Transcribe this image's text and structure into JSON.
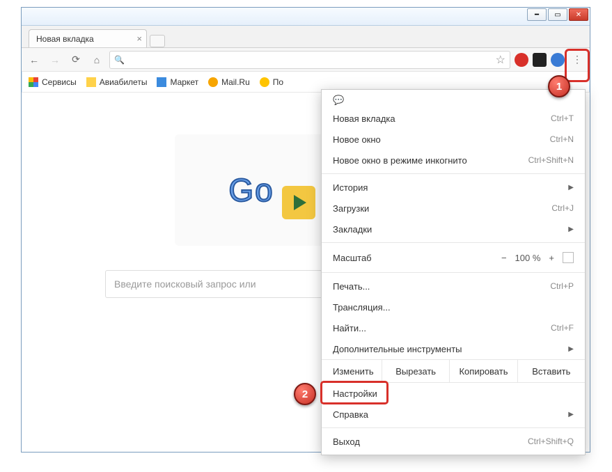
{
  "window": {
    "title": ""
  },
  "tab": {
    "title": "Новая вкладка"
  },
  "omnibox": {
    "value": "",
    "placeholder": ""
  },
  "bookmarks": {
    "items": [
      {
        "label": "Сервисы"
      },
      {
        "label": "Авиабилеты"
      },
      {
        "label": "Маркет"
      },
      {
        "label": "Mail.Ru"
      },
      {
        "label": "По"
      }
    ]
  },
  "page": {
    "doodle_text": "Go",
    "search_placeholder": "Введите поисковый запрос или"
  },
  "menu": {
    "new_tab": "Новая вкладка",
    "new_tab_sc": "Ctrl+T",
    "new_window": "Новое окно",
    "new_window_sc": "Ctrl+N",
    "incognito": "Новое окно в режиме инкогнито",
    "incognito_sc": "Ctrl+Shift+N",
    "history": "История",
    "downloads": "Загрузки",
    "downloads_sc": "Ctrl+J",
    "bookmarks": "Закладки",
    "zoom_label": "Масштаб",
    "zoom_value": "100 %",
    "print": "Печать...",
    "print_sc": "Ctrl+P",
    "cast": "Трансляция...",
    "find": "Найти...",
    "find_sc": "Ctrl+F",
    "more_tools": "Дополнительные инструменты",
    "edit_label": "Изменить",
    "cut": "Вырезать",
    "copy": "Копировать",
    "paste": "Вставить",
    "settings": "Настройки",
    "help": "Справка",
    "exit": "Выход",
    "exit_sc": "Ctrl+Shift+Q"
  },
  "callouts": {
    "one": "1",
    "two": "2"
  }
}
